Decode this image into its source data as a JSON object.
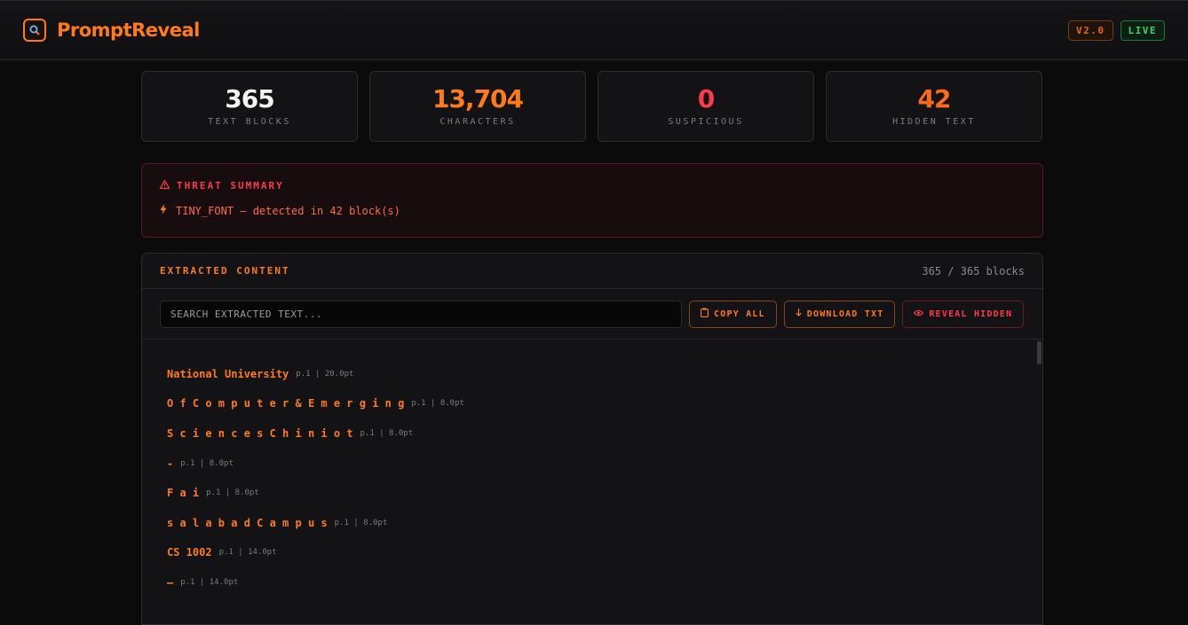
{
  "app": {
    "title": "PromptReveal",
    "logo_icon": "magnifier-icon"
  },
  "badges": {
    "version": "V2.0",
    "status": "LIVE"
  },
  "colors": {
    "accent": "#ff7a1a",
    "danger": "#ff3b4a",
    "live": "#3ed26a"
  },
  "stats": [
    {
      "value": "365",
      "label": "TEXT BLOCKS",
      "color": "#f2f2f2"
    },
    {
      "value": "13,704",
      "label": "CHARACTERS",
      "color": "#ff7a1a"
    },
    {
      "value": "0",
      "label": "SUSPICIOUS",
      "color": "#ff3b4a"
    },
    {
      "value": "42",
      "label": "HIDDEN TEXT",
      "color": "#ff6a1a"
    }
  ],
  "threat": {
    "title": "THREAT SUMMARY",
    "items": [
      {
        "text": "TINY_FONT — detected in 42 block(s)"
      }
    ]
  },
  "content": {
    "title": "EXTRACTED CONTENT",
    "count": "365 / 365 blocks",
    "search_placeholder": "SEARCH EXTRACTED TEXT...",
    "buttons": {
      "copy": "COPY ALL",
      "download": "DOWNLOAD TXT",
      "reveal": "REVEAL HIDDEN"
    },
    "blocks": [
      {
        "text": "National University",
        "page": "p.1",
        "size": "20.0pt"
      },
      {
        "text": "O f C o m p u t e r & E m e r g i n g",
        "page": "p.1",
        "size": "8.0pt"
      },
      {
        "text": "S c i e n c e s C h i n i o t",
        "page": "p.1",
        "size": "8.0pt"
      },
      {
        "text": "-",
        "page": "p.1",
        "size": "8.0pt"
      },
      {
        "text": "F a i",
        "page": "p.1",
        "size": "8.0pt"
      },
      {
        "text": "s a l a b a d C a m p u s",
        "page": "p.1",
        "size": "8.0pt"
      },
      {
        "text": "CS 1002",
        "page": "p.1",
        "size": "14.0pt"
      },
      {
        "text": "—",
        "page": "p.1",
        "size": "14.0pt"
      }
    ]
  }
}
